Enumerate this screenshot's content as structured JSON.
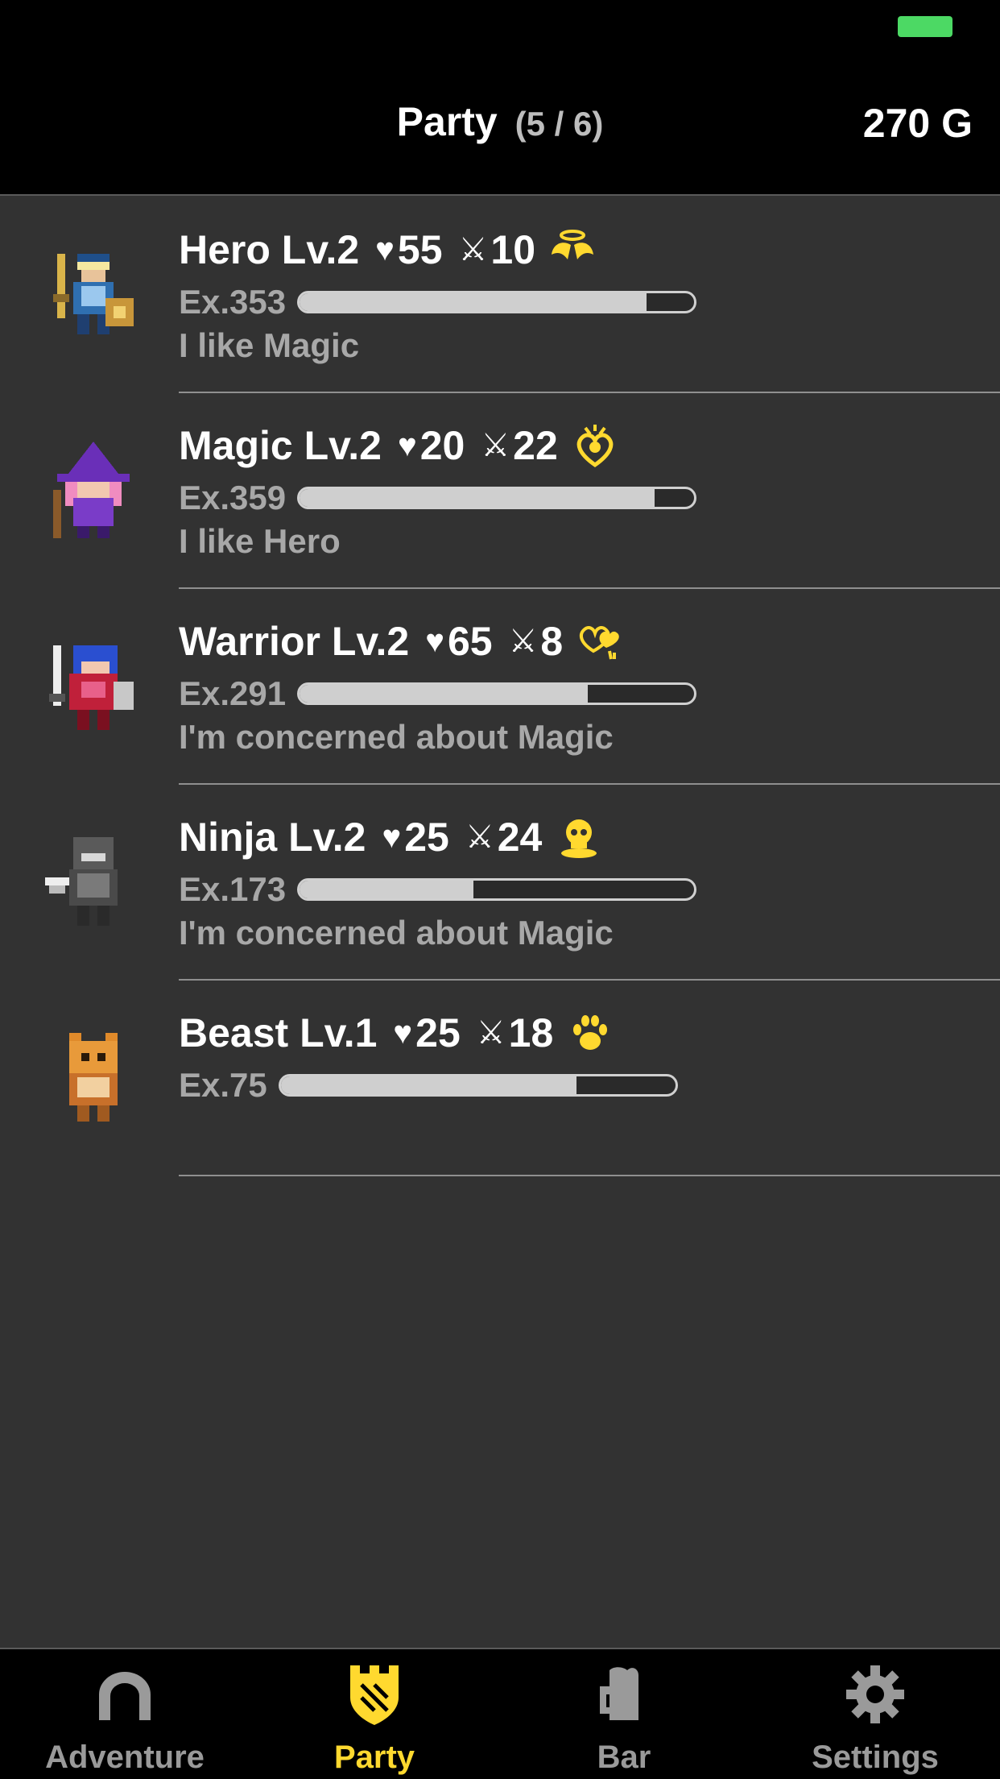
{
  "header": {
    "title": "Party",
    "count": "(5 / 6)",
    "gold": "270 G",
    "battery_color": "#4cd964"
  },
  "party": [
    {
      "name": "Hero Lv.2",
      "hp": "55",
      "atk": "10",
      "trait_icon": "halo-wings-icon",
      "exp": "Ex.353",
      "exp_progress": 0.88,
      "status": "I like Magic"
    },
    {
      "name": "Magic Lv.2",
      "hp": "20",
      "atk": "22",
      "trait_icon": "swirl-heart-icon",
      "exp": "Ex.359",
      "exp_progress": 0.9,
      "status": "I like Hero"
    },
    {
      "name": "Warrior Lv.2",
      "hp": "65",
      "atk": "8",
      "trait_icon": "broken-hearts-icon",
      "exp": "Ex.291",
      "exp_progress": 0.73,
      "status": "I'm concerned about Magic"
    },
    {
      "name": "Ninja Lv.2",
      "hp": "25",
      "atk": "24",
      "trait_icon": "skull-icon",
      "exp": "Ex.173",
      "exp_progress": 0.44,
      "status": "I'm concerned about Magic"
    },
    {
      "name": "Beast Lv.1",
      "hp": "25",
      "atk": "18",
      "trait_icon": "paw-icon",
      "exp": "Ex.75",
      "exp_progress": 0.75,
      "status": ""
    }
  ],
  "symbols": {
    "heart": "♥",
    "sword": "⚔"
  },
  "tabs": [
    {
      "label": "Adventure",
      "icon": "arch-icon",
      "active": false
    },
    {
      "label": "Party",
      "icon": "castle-shield-icon",
      "active": true
    },
    {
      "label": "Bar",
      "icon": "mug-icon",
      "active": false
    },
    {
      "label": "Settings",
      "icon": "gear-icon",
      "active": false
    }
  ],
  "colors": {
    "accent": "#ffd92f",
    "background": "#323232",
    "bar_fill": "#cfcfcf"
  }
}
